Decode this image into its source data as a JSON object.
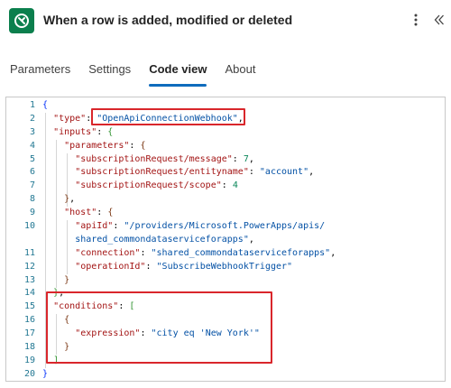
{
  "header": {
    "title": "When a row is added, modified or deleted",
    "app_icon": "dataverse-icon",
    "more_icon": "more-vertical-icon",
    "collapse_icon": "double-chevron-left-icon"
  },
  "tabs": [
    {
      "label": "Parameters",
      "active": false
    },
    {
      "label": "Settings",
      "active": false
    },
    {
      "label": "Code view",
      "active": true
    },
    {
      "label": "About",
      "active": false
    }
  ],
  "colors": {
    "accent": "#0f6cbd",
    "highlight": "#d9262b",
    "app_icon_bg": "#0b7f4d"
  },
  "code": {
    "lines": [
      {
        "num": "1",
        "text": "{"
      },
      {
        "num": "2",
        "text": "  \"type\": \"OpenApiConnectionWebhook\","
      },
      {
        "num": "3",
        "text": "  \"inputs\": {"
      },
      {
        "num": "4",
        "text": "    \"parameters\": {"
      },
      {
        "num": "5",
        "text": "      \"subscriptionRequest/message\": 7,"
      },
      {
        "num": "6",
        "text": "      \"subscriptionRequest/entityname\": \"account\","
      },
      {
        "num": "7",
        "text": "      \"subscriptionRequest/scope\": 4"
      },
      {
        "num": "8",
        "text": "    },"
      },
      {
        "num": "9",
        "text": "    \"host\": {"
      },
      {
        "num": "10",
        "text": "      \"apiId\": \"/providers/Microsoft.PowerApps/apis/"
      },
      {
        "num": "",
        "text": "      shared_commondataserviceforapps\","
      },
      {
        "num": "11",
        "text": "      \"connection\": \"shared_commondataserviceforapps\","
      },
      {
        "num": "12",
        "text": "      \"operationId\": \"SubscribeWebhookTrigger\""
      },
      {
        "num": "13",
        "text": "    }"
      },
      {
        "num": "14",
        "text": "  },"
      },
      {
        "num": "15",
        "text": "  \"conditions\": ["
      },
      {
        "num": "16",
        "text": "    {"
      },
      {
        "num": "17",
        "text": "      \"expression\": \"city eq 'New York'\""
      },
      {
        "num": "18",
        "text": "    }"
      },
      {
        "num": "19",
        "text": "  ]"
      },
      {
        "num": "20",
        "text": "}"
      }
    ]
  }
}
